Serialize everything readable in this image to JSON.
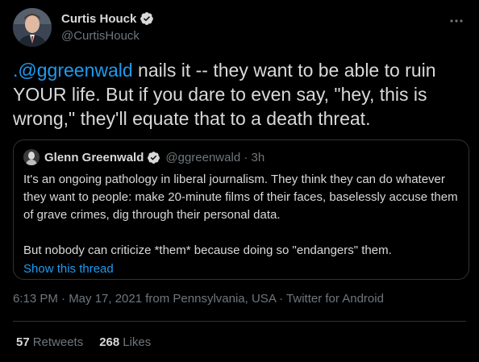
{
  "author": {
    "display_name": "Curtis Houck",
    "handle": "@CurtisHouck",
    "avatar_icon": "profile-photo"
  },
  "tweet": {
    "mention": ".@ggreenwald",
    "text_after_mention": " nails it -- they want to be able to ruin YOUR life. But if you dare to even say, \"hey, this is wrong,\" they'll equate that to a death threat."
  },
  "quote": {
    "display_name": "Glenn Greenwald",
    "meta": "@ggreenwald · 3h",
    "body": "It's an ongoing pathology in liberal journalism. They think they can do whatever they want to people: make 20-minute films of their faces, baselessly accuse them of grave crimes, dig through their personal data.\n\nBut nobody can criticize *them* because doing so \"endangers\" them.",
    "show_thread": "Show this thread"
  },
  "timestamp": "6:13 PM · May 17, 2021 from Pennsylvania, USA · Twitter for Android",
  "stats": {
    "retweets_count": "57",
    "retweets_label": "Retweets",
    "likes_count": "268",
    "likes_label": "Likes"
  },
  "colors": {
    "background": "#000000",
    "text": "#d9d9d9",
    "secondary": "#6e767d",
    "accent": "#1d9bf0",
    "border": "#2f3336"
  }
}
